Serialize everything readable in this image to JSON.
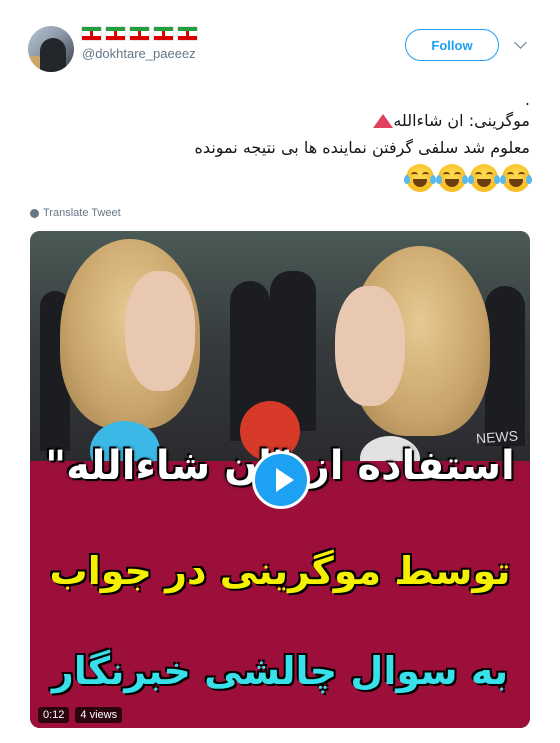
{
  "header": {
    "flags": [
      "iran-flag",
      "iran-flag",
      "iran-flag",
      "iran-flag",
      "iran-flag"
    ],
    "handle": "@dokhtare_paeeez",
    "follow_label": "Follow"
  },
  "tweet": {
    "dot_line": ".",
    "line1": "موگرینی: ان شاءالله",
    "line2": "معلوم شد سلفی گرفتن نماینده ها بی نتیجه نمونده",
    "emojis": [
      "tears-of-joy-emoji",
      "tears-of-joy-emoji",
      "tears-of-joy-emoji",
      "tears-of-joy-emoji"
    ],
    "translate_label": "Translate Tweet"
  },
  "video": {
    "overlay_line1": "استفاده از \"ان شاءالله\"",
    "overlay_line2": "توسط موگرینی در جواب",
    "overlay_line3": "به سوال چالشی خبرنگار",
    "watermark": "NEWS",
    "duration": "0:12",
    "views": "4 views"
  },
  "colors": {
    "accent": "#1da1f2",
    "banner": "#9c0f3a",
    "overlay_yellow": "#f4f000",
    "overlay_cyan": "#38e0ea",
    "triangle": "#e0415d"
  }
}
